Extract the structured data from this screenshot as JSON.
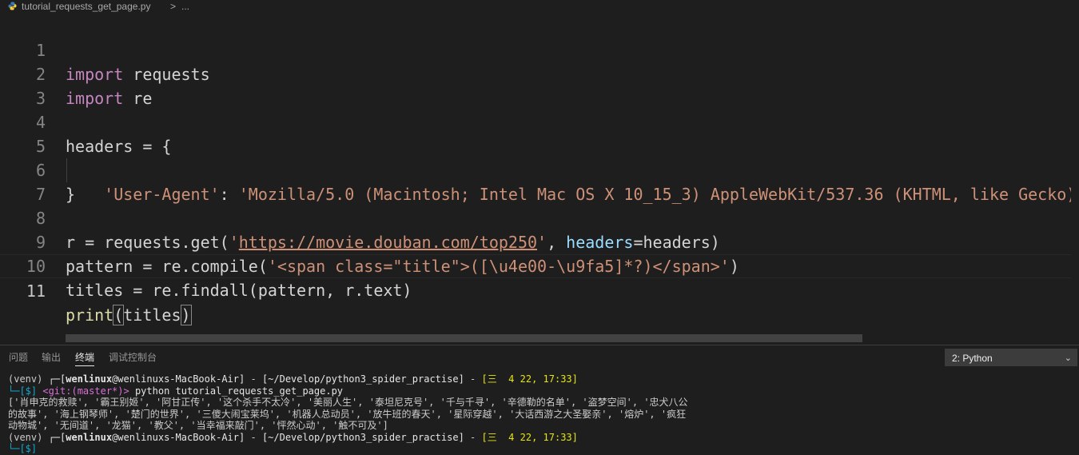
{
  "breadcrumb": {
    "file_icon": "python-file-icon",
    "filename": "tutorial_requests_get_page.py",
    "separator": ">",
    "more": "..."
  },
  "editor": {
    "language": "python",
    "lines": [
      {
        "num": "1"
      },
      {
        "num": "2"
      },
      {
        "num": "3"
      },
      {
        "num": "4"
      },
      {
        "num": "5"
      },
      {
        "num": "6"
      },
      {
        "num": "7"
      },
      {
        "num": "8"
      },
      {
        "num": "9"
      },
      {
        "num": "10"
      },
      {
        "num": "11"
      }
    ],
    "tokens": {
      "l1_kw": "import",
      "l1_rest": " requests",
      "l2_kw": "import",
      "l2_rest": " re",
      "l4": "headers = {",
      "l5_indent": "    ",
      "l5_key": "'User-Agent'",
      "l5_colon": ": ",
      "l5_val": "'Mozilla/5.0 (Macintosh; Intel Mac OS X 10_15_3) AppleWebKit/537.36 (KHTML, like Gecko) C",
      "l6": "}",
      "l8_a": "r = requests.get(",
      "l8_q1": "'",
      "l8_url": "https://movie.douban.com/top250",
      "l8_q2": "'",
      "l8_b": ", ",
      "l8_param": "headers",
      "l8_c": "=headers)",
      "l9_a": "pattern = re.compile(",
      "l9_str": "'<span class=\"title\">([\\u4e00-\\u9fa5]*?)</span>'",
      "l9_b": ")",
      "l10": "titles = re.findall(pattern, r.text)",
      "l11_fn": "print",
      "l11_open": "(",
      "l11_arg": "titles",
      "l11_close": ")"
    }
  },
  "panel": {
    "tabs": [
      {
        "label": "问题",
        "active": false
      },
      {
        "label": "输出",
        "active": false
      },
      {
        "label": "终端",
        "active": true
      },
      {
        "label": "调试控制台",
        "active": false
      }
    ],
    "terminal_selector": "2: Python",
    "terminal": {
      "p1_venv": "(venv) ",
      "p1_box": "┌─[",
      "p1_user": "wenlinux",
      "p1_at": "@wenlinuxs-MacBook-Air",
      "p1_close": "]",
      "p1_sep": " - ",
      "p1_path": "[~/Develop/python3_spider_practise]",
      "p1_sep2": " - ",
      "p1_date": "[三  4 22, 17:33]",
      "p2_box": "└─[$]",
      "p2_git": " <git:(master*)>",
      "p2_cmd": " python tutorial_requests_get_page.py",
      "out1": "['肖申克的救赎', '霸王别姬', '阿甘正传', '这个杀手不太冷', '美丽人生', '泰坦尼克号', '千与千寻', '辛德勒的名单', '盗梦空间', '忠犬八公",
      "out2": "的故事', '海上钢琴师', '楚门的世界', '三傻大闹宝莱坞', '机器人总动员', '放牛班的春天', '星际穿越', '大话西游之大圣娶亲', '熔炉', '疯狂",
      "out3": "动物城', '无间道', '龙猫', '教父', '当幸福来敲门', '怦然心动', '触不可及']",
      "p3_date": "[三  4 22, 17:33]",
      "p4_box": "└─[$]"
    }
  }
}
